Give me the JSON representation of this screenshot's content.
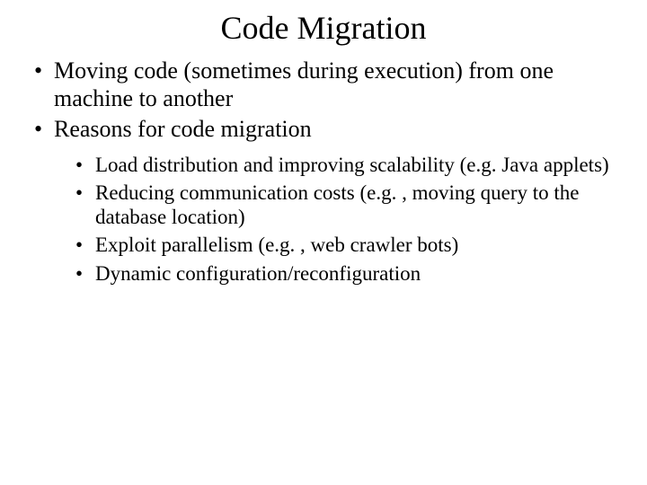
{
  "title": "Code Migration",
  "bullets": {
    "b0": "Moving code (sometimes during execution) from one machine to another",
    "b1": "Reasons for code migration",
    "sub": {
      "s0": "Load distribution and improving scalability (e.g. Java applets)",
      "s1": "Reducing communication costs (e.g. , moving query to the database location)",
      "s2": "Exploit parallelism (e.g. , web crawler bots)",
      "s3": "Dynamic configuration/reconfiguration"
    }
  }
}
